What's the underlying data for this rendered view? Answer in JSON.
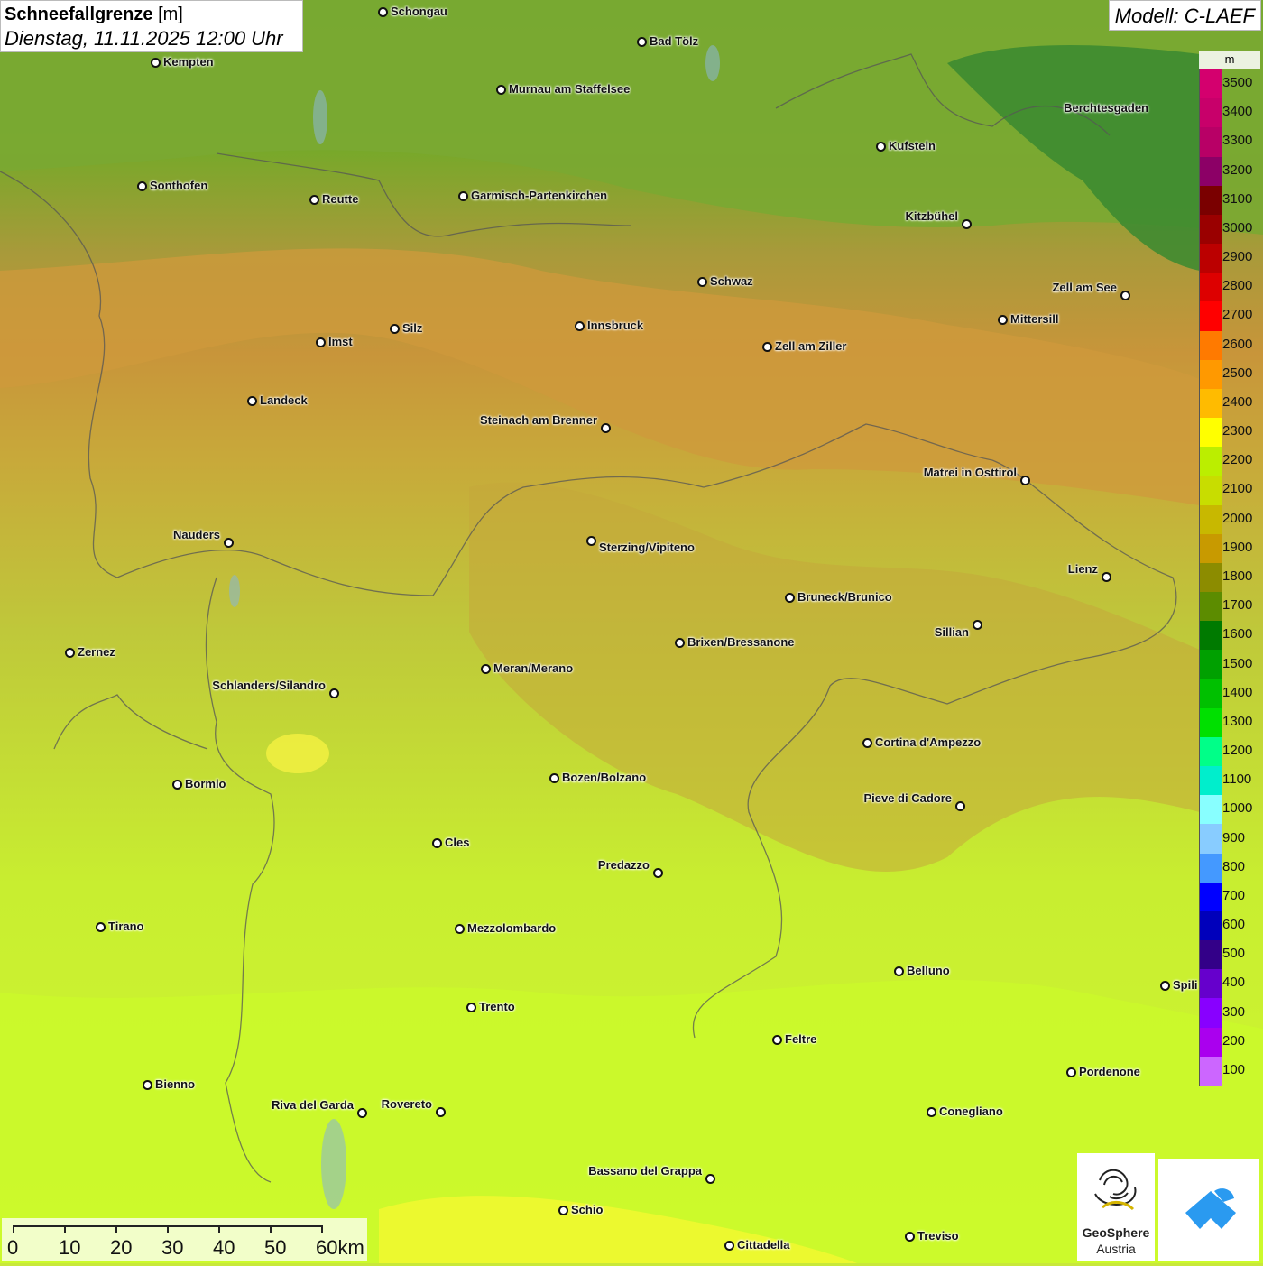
{
  "header": {
    "title_bold": "Schneefallgrenze",
    "title_unit": "[m]",
    "datetime": "Dienstag, 11.11.2025 12:00 Uhr",
    "model": "Modell: C-LAEF"
  },
  "legend": {
    "unit": "m",
    "labels": [
      "3500",
      "3400",
      "3300",
      "3200",
      "3100",
      "3000",
      "2900",
      "2800",
      "2700",
      "2600",
      "2500",
      "2400",
      "2300",
      "2200",
      "2100",
      "2000",
      "1900",
      "1800",
      "1700",
      "1600",
      "1500",
      "1400",
      "1300",
      "1200",
      "1100",
      "1000",
      "900",
      "800",
      "700",
      "600",
      "500",
      "400",
      "300",
      "200",
      "100"
    ],
    "colors": [
      "#d4006e",
      "#c8006a",
      "#b80066",
      "#8c0066",
      "#7a0000",
      "#9a0000",
      "#bb0000",
      "#dd0000",
      "#ff0000",
      "#ff7a00",
      "#ff9900",
      "#ffbb00",
      "#ffff00",
      "#bbee00",
      "#c8dd00",
      "#c8b800",
      "#c89a00",
      "#8c8c00",
      "#5c8c00",
      "#007a00",
      "#00a000",
      "#00c000",
      "#00e000",
      "#00ff88",
      "#00eecc",
      "#88ffff",
      "#88ccff",
      "#4499ff",
      "#0000ff",
      "#0000bb",
      "#330088",
      "#6600cc",
      "#8800ff",
      "#aa00ee",
      "#cc66ff"
    ]
  },
  "cities": [
    {
      "name": "Schongau"
    },
    {
      "name": "Bad Tölz"
    },
    {
      "name": "Kempten"
    },
    {
      "name": "Murnau am Staffelsee"
    },
    {
      "name": "Kufstein"
    },
    {
      "name": "Berchtesgaden"
    },
    {
      "name": "Sonthofen"
    },
    {
      "name": "Reutte"
    },
    {
      "name": "Garmisch-Partenkirchen"
    },
    {
      "name": "Kitzbühel"
    },
    {
      "name": "Schwaz"
    },
    {
      "name": "Zell am See"
    },
    {
      "name": "Innsbruck"
    },
    {
      "name": "Mittersill"
    },
    {
      "name": "Imst"
    },
    {
      "name": "Silz"
    },
    {
      "name": "Zell am Ziller"
    },
    {
      "name": "Landeck"
    },
    {
      "name": "Steinach am Brenner"
    },
    {
      "name": "Matrei in Osttirol"
    },
    {
      "name": "Nauders"
    },
    {
      "name": "Sterzing/Vipiteno"
    },
    {
      "name": "Lienz"
    },
    {
      "name": "Bruneck/Brunico"
    },
    {
      "name": "Sillian"
    },
    {
      "name": "Brixen/Bressanone"
    },
    {
      "name": "Zernez"
    },
    {
      "name": "Meran/Merano"
    },
    {
      "name": "Schlanders/Silandro"
    },
    {
      "name": "Cortina d'Ampezzo"
    },
    {
      "name": "Bormio"
    },
    {
      "name": "Bozen/Bolzano"
    },
    {
      "name": "Pieve di Cadore"
    },
    {
      "name": "Cles"
    },
    {
      "name": "Predazzo"
    },
    {
      "name": "Tirano"
    },
    {
      "name": "Mezzolombardo"
    },
    {
      "name": "Belluno"
    },
    {
      "name": "Spili"
    },
    {
      "name": "Trento"
    },
    {
      "name": "Feltre"
    },
    {
      "name": "Pordenone"
    },
    {
      "name": "Bienno"
    },
    {
      "name": "Riva del Garda"
    },
    {
      "name": "Rovereto"
    },
    {
      "name": "Conegliano"
    },
    {
      "name": "Bassano del Grappa"
    },
    {
      "name": "Schio"
    },
    {
      "name": "Treviso"
    },
    {
      "name": "Cittadella"
    }
  ],
  "scale": {
    "labels": [
      "0",
      "10",
      "20",
      "30",
      "40",
      "50",
      "60km"
    ]
  },
  "logos": {
    "geosphere_line1": "GeoSphere",
    "geosphere_line2": "Austria"
  }
}
